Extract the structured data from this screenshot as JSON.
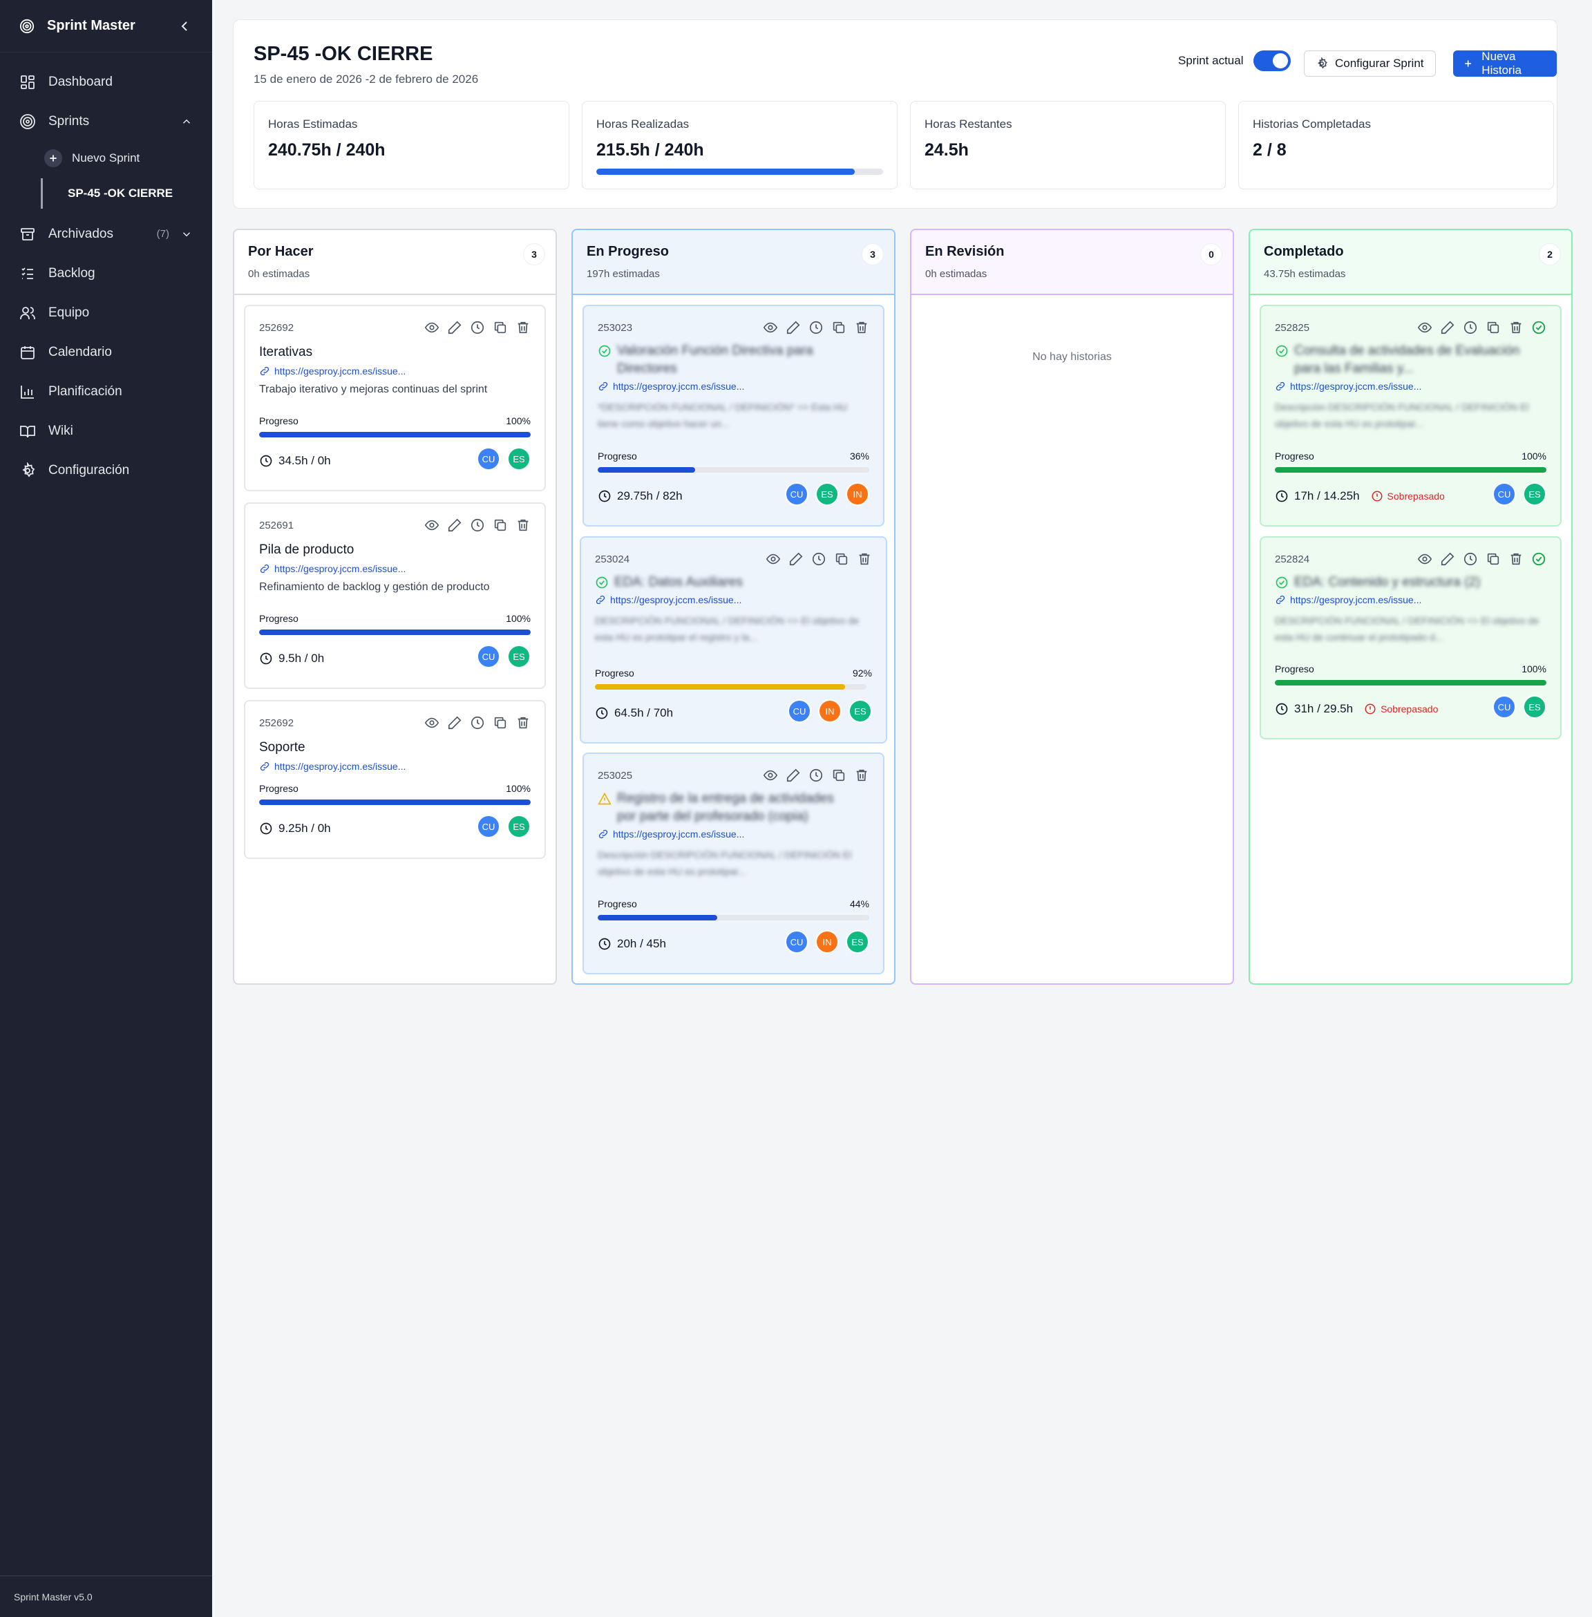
{
  "app": {
    "title": "Sprint Master",
    "version": "Sprint Master v5.0"
  },
  "sidebar": {
    "items": [
      {
        "label": "Dashboard",
        "icon": "dashboard-icon"
      },
      {
        "label": "Sprints",
        "icon": "target-icon"
      },
      {
        "label": "Archivados",
        "icon": "archive-icon",
        "count": "(7)"
      },
      {
        "label": "Backlog",
        "icon": "list-icon"
      },
      {
        "label": "Equipo",
        "icon": "users-icon"
      },
      {
        "label": "Calendario",
        "icon": "calendar-icon"
      },
      {
        "label": "Planificación",
        "icon": "bar-chart-icon"
      },
      {
        "label": "Wiki",
        "icon": "book-icon"
      },
      {
        "label": "Configuración",
        "icon": "gear-icon"
      }
    ],
    "new_sprint": "Nuevo Sprint",
    "active_sprint": "SP-45 -OK CIERRE"
  },
  "header": {
    "title": "SP-45 -OK CIERRE",
    "dates": "15 de enero de 2026 -2 de febrero de 2026",
    "toggle_label": "Sprint actual",
    "config_button": "Configurar Sprint",
    "new_button": "Nueva Historia"
  },
  "stats": [
    {
      "label": "Horas Estimadas",
      "value": "240.75h / 240h"
    },
    {
      "label": "Horas Realizadas",
      "value": "215.5h / 240h",
      "progress": 0.9
    },
    {
      "label": "Horas Restantes",
      "value": "24.5h"
    },
    {
      "label": "Historias Completadas",
      "value": "2 / 8"
    }
  ],
  "columns": [
    {
      "title": "Por Hacer",
      "subtitle": "0h estimadas",
      "count": "3"
    },
    {
      "title": "En Progreso",
      "subtitle": "197h estimadas",
      "count": "3"
    },
    {
      "title": "En Revisión",
      "subtitle": "0h estimadas",
      "count": "0",
      "empty": "No hay historias"
    },
    {
      "title": "Completado",
      "subtitle": "43.75h estimadas",
      "count": "2"
    }
  ],
  "cards": {
    "todo": [
      {
        "id": "252692",
        "title": "Iterativas",
        "link": "https://gesproy.jccm.es/issue...",
        "desc": "Trabajo iterativo y mejoras continuas del sprint",
        "progress_label": "Progreso",
        "progress_text": "100%",
        "progress": 1.0,
        "hours": "34.5h / 0h",
        "avatars": [
          "CU",
          "ES"
        ]
      },
      {
        "id": "252691",
        "title": "Pila de producto",
        "link": "https://gesproy.jccm.es/issue...",
        "desc": "Refinamiento de backlog y gestión de producto",
        "progress_label": "Progreso",
        "progress_text": "100%",
        "progress": 1.0,
        "hours": "9.5h / 0h",
        "avatars": [
          "CU",
          "ES"
        ]
      },
      {
        "id": "252692",
        "title": "Soporte",
        "link": "https://gesproy.jccm.es/issue...",
        "progress_label": "Progreso",
        "progress_text": "100%",
        "progress": 1.0,
        "hours": "9.25h / 0h",
        "avatars": [
          "CU",
          "ES"
        ]
      }
    ],
    "inprogress": [
      {
        "id": "253023",
        "title": "Valoración Función Directiva para Directores",
        "link": "https://gesproy.jccm.es/issue...",
        "desc": "*DESCRIPCIÓN FUNCIONAL / DEFINICIÓN* => Esta HU tiene como objetivo hacer un...",
        "progress_label": "Progreso",
        "progress_text": "36%",
        "progress": 0.36,
        "hours": "29.75h / 82h",
        "avatars": [
          "CU",
          "ES",
          "IN"
        ]
      },
      {
        "id": "253024",
        "title": "EDA: Datos Auxiliares",
        "link": "https://gesproy.jccm.es/issue...",
        "desc": "DESCRIPCIÓN FUNCIONAL / DEFINICIÓN => El objetivo de esta HU es prototipar el registro y la...",
        "progress_label": "Progreso",
        "progress_text": "92%",
        "progress": 0.92,
        "hours": "64.5h / 70h",
        "avatars": [
          "CU",
          "IN",
          "ES"
        ]
      },
      {
        "id": "253025",
        "title": "Registro de la entrega de actividades por parte del profesorado (copia)",
        "link": "https://gesproy.jccm.es/issue...",
        "desc": "Descripción DESCRIPCIÓN FUNCIONAL / DEFINICIÓN El objetivo de esta HU es prototipar...",
        "progress_label": "Progreso",
        "progress_text": "44%",
        "progress": 0.44,
        "hours": "20h / 45h",
        "avatars": [
          "CU",
          "IN",
          "ES"
        ]
      }
    ],
    "done": [
      {
        "id": "252825",
        "title": "Consulta de actividades de Evaluación para las Familias y...",
        "link": "https://gesproy.jccm.es/issue...",
        "desc": "Descripción DESCRIPCIÓN FUNCIONAL / DEFINICIÓN El objetivo de esta HU es prototipar...",
        "progress_label": "Progreso",
        "progress_text": "100%",
        "progress": 1.0,
        "hours": "17h / 14.25h",
        "over": "Sobrepasado",
        "avatars": [
          "CU",
          "ES"
        ]
      },
      {
        "id": "252824",
        "title": "EDA: Contenido y estructura (2)",
        "link": "https://gesproy.jccm.es/issue...",
        "desc": "DESCRIPCIÓN FUNCIONAL / DEFINICIÓN => El objetivo de esta HU de continuar el prototipado d...",
        "progress_label": "Progreso",
        "progress_text": "100%",
        "progress": 1.0,
        "hours": "31h / 29.5h",
        "over": "Sobrepasado",
        "avatars": [
          "CU",
          "ES"
        ]
      }
    ]
  },
  "colors": {
    "accent": "#1d5fe0",
    "sidebar": "#1f2230",
    "danger": "#dc2626"
  }
}
